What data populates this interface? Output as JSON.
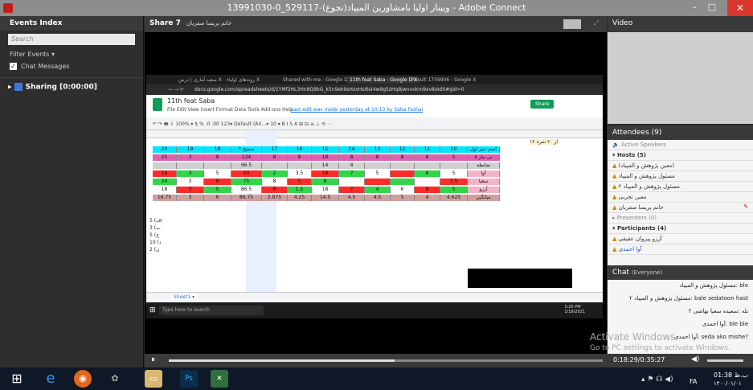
{
  "window": {
    "title": "13991030-0_529117-(تجوع)وبینار اولیا بامشاورین المپیاد - Adobe Connect",
    "minimize": "–",
    "maximize": "□",
    "close": "✕"
  },
  "events": {
    "title": "Events Index",
    "search_placeholder": "Search",
    "filter": "Filter Events ▾",
    "chat_messages": "Chat Messages",
    "sharing": "Sharing [0:00:00]"
  },
  "share_pod": {
    "title": "Share 7",
    "subtitle": "خانم پریسا صفریان"
  },
  "screen": {
    "tabs": [
      "سعید آماری | درس X",
      "روندهای اولیاء X",
      "Shared with me - Google D X",
      "11th feat Saba - Google D X",
      "Result 1759906 - Google X"
    ],
    "url": "docs.google.com/spreadsheets/d/1YMf2HL3Hn8Q9bG_k5n9ek9sHzxHsI6sI4w9g5zHq8jwnvokm9xv8/edit#gid=0",
    "doc_title": "11th feat Saba",
    "menu": "File  Edit  View  Insert  Format  Data  Tools  Add-ons  Help",
    "last_edit": "Last edit was made yesterday at 10:13 by Saba Fashai",
    "share_button": "Share",
    "toolbar": "↶ ↷ 🖶 ⇩  100% ▾  $  %  .0  .00  123▾  Default (Ari...▾  10 ▾  B  I  S  A  ⊞  ⊟  ≡  ⊥  ⟲  ⋯",
    "formula_ref": "fx",
    "rows": [
      {
        "bg": "#00e5ff",
        "cells": [
          "20",
          "19",
          "18",
          "سمیح ۲",
          "17",
          "16",
          "15",
          "14",
          "13",
          "12",
          "11",
          "10",
          "اسم دبیر اول"
        ]
      },
      {
        "bg": "#e060b0",
        "cells": [
          "25",
          "3",
          "8",
          "134",
          "8",
          "8",
          "18",
          "8",
          "8",
          "8",
          "6",
          "5",
          "۵ بی نیاز"
        ]
      },
      {
        "bg": "#d0d0d0",
        "cells": [
          "",
          "",
          "",
          "96.5",
          "",
          "",
          "14",
          "4",
          "",
          "",
          "",
          "",
          "ضابطه"
        ]
      },
      {
        "bg": "#ffffff",
        "cells": [
          "18",
          "3",
          "5",
          "90",
          "2",
          "3.5",
          "18",
          "7",
          "5",
          "",
          "6",
          "5",
          "آوا"
        ]
      },
      {
        "bg": "#ffffff",
        "cells": [
          "24",
          "3",
          "6",
          "75",
          "8",
          "5",
          "8",
          "",
          "",
          "",
          "",
          "3.5",
          "سعیا"
        ]
      },
      {
        "bg": "#ffffff",
        "cells": [
          "18",
          "3",
          "5",
          "86.5",
          "8",
          "1.5",
          "18",
          "7",
          "4",
          "6",
          "8",
          "5",
          "آرزو"
        ]
      },
      {
        "bg": "#d0a0a0",
        "cells": [
          "16.75",
          "3",
          "6",
          "86.75",
          "2.875",
          "4.25",
          "14.5",
          "4.5",
          "4.5",
          "5",
          "4",
          "4.625",
          "میانگین"
        ]
      }
    ],
    "side_labels": [
      "5 (اف",
      "3 (ب",
      "5 (ج",
      "10 (د",
      "2 (ن"
    ],
    "sheet_tab": "Sheet1 ▾",
    "taskbar_search": "Type here to search",
    "clock": "3:25 PM\n1/19/2021"
  },
  "video": {
    "title": "Video"
  },
  "attendees": {
    "title": "Attendees (9)",
    "active_speakers": "Active Speakers",
    "hosts": "Hosts (5)",
    "host_list": [
      "(معین پژوهش و المپیاد)",
      "مسئول پژوهش و المپیاد",
      "مسئول پژوهش و المپیاد ۲",
      "معین تجربی",
      "خانم پریسا صفریان"
    ],
    "presenters": "Presenters (0)",
    "participants": "Participants (4)",
    "participant_list": [
      "آرزو پیروان عقیقی",
      "آوا احمدی"
    ]
  },
  "chat": {
    "title": "Chat",
    "scope": "(Everyone)",
    "messages": [
      "مسئول پژوهش و المپیاد: ble",
      "مسئول پژوهش و المپیاد ۲: bale sedatoon hast",
      "بله :سعیده سعیا بهاشی ۲",
      "آوا احمدی: ble ble",
      "آوا احمدی: seda ako mishe?"
    ],
    "watermark_1": "Activate Windows",
    "watermark_2": "Go to PC settings to activate Windows."
  },
  "controls": {
    "play": "⏸",
    "time": "0:18:29/0:35:27",
    "progress": 0.52
  },
  "taskbar": {
    "time": "01:38 ب.ظ",
    "date": "۱۴۰۰/۰۱/۰۱",
    "lang": "FA"
  }
}
